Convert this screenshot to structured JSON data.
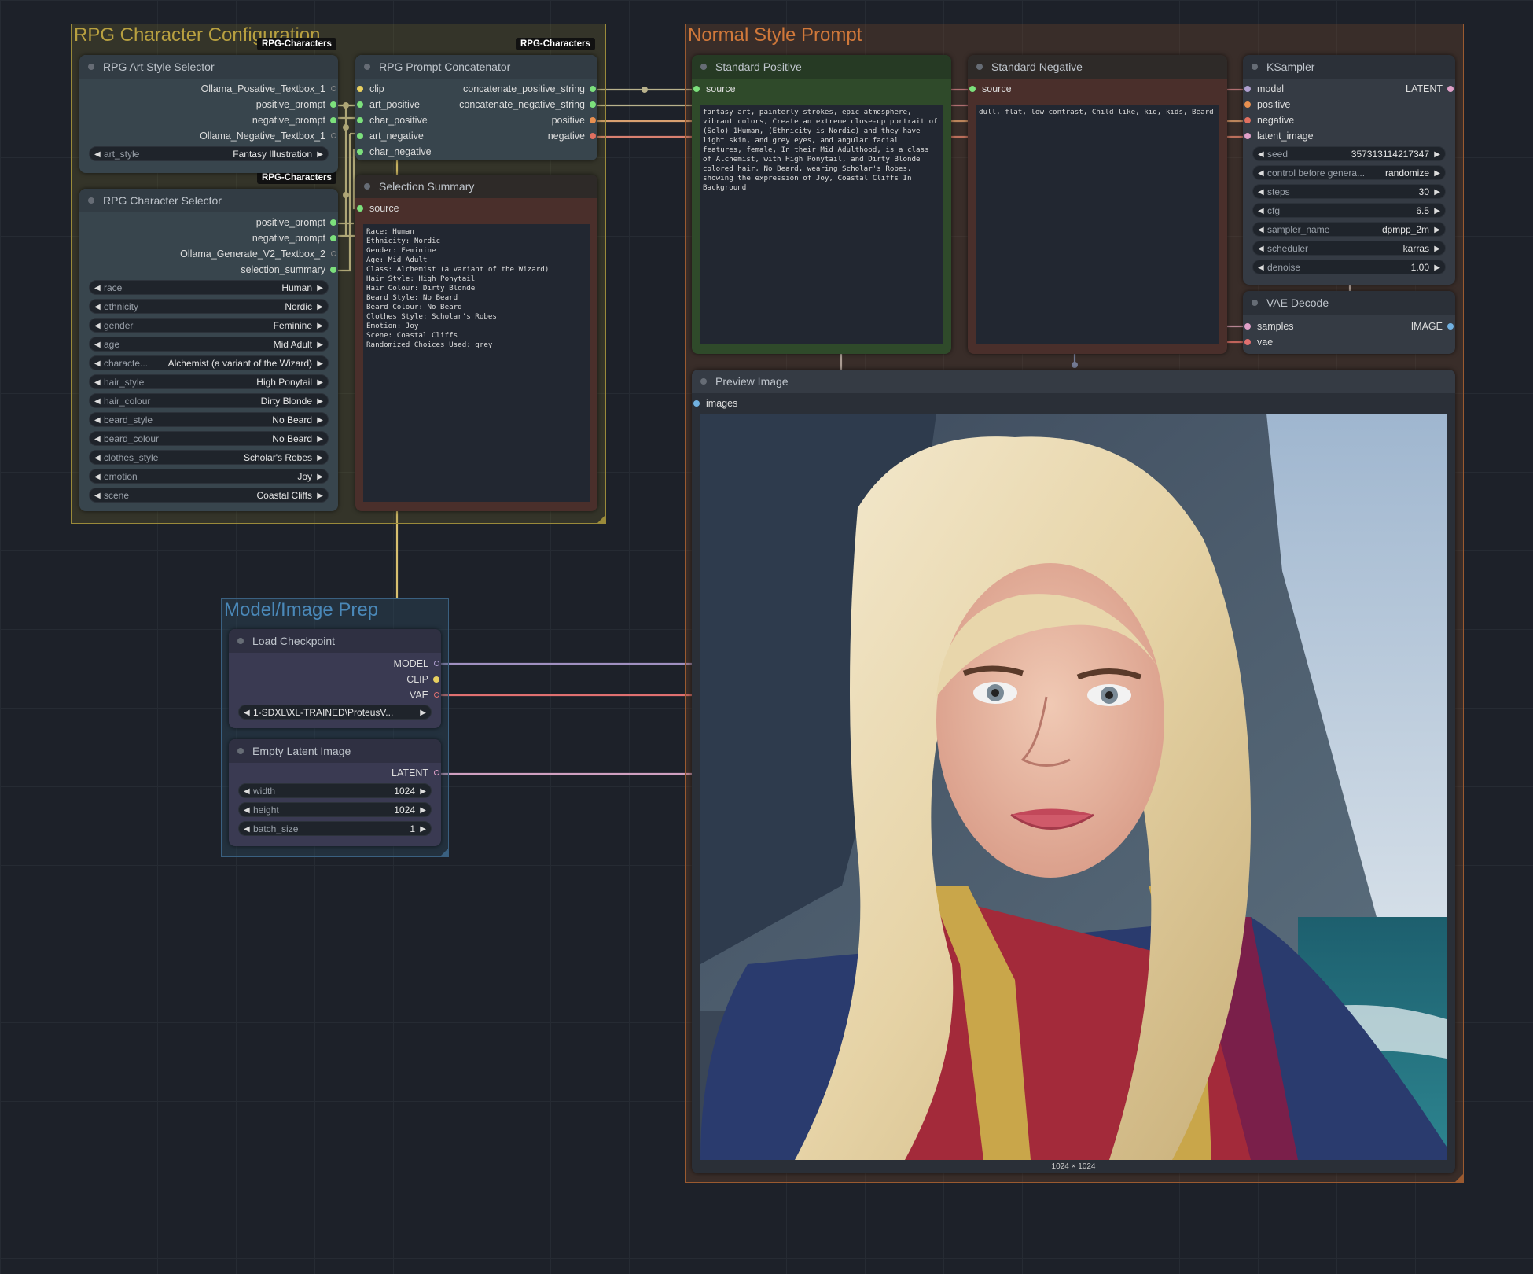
{
  "groups": {
    "rpg": {
      "title": "RPG Character Configuration"
    },
    "normal": {
      "title": "Normal Style Prompt"
    },
    "prep": {
      "title": "Model/Image Prep"
    }
  },
  "badges": {
    "badge1": "RPG-Characters",
    "badge2": "RPG-Characters",
    "badge3": "RPG-Characters"
  },
  "art_style_selector": {
    "title": "RPG Art Style Selector",
    "outputs": [
      "Ollama_Posative_Textbox_1",
      "positive_prompt",
      "negative_prompt",
      "Ollama_Negative_Textbox_1"
    ],
    "widget": {
      "label": "art_style",
      "value": "Fantasy Illustration"
    }
  },
  "prompt_concat": {
    "title": "RPG Prompt Concatenator",
    "inputs": [
      "clip",
      "art_positive",
      "char_positive",
      "art_negative",
      "char_negative"
    ],
    "outputs": [
      "concatenate_positive_string",
      "concatenate_negative_string",
      "positive",
      "negative"
    ]
  },
  "char_selector": {
    "title": "RPG Character Selector",
    "outputs": [
      "positive_prompt",
      "negative_prompt",
      "Ollama_Generate_V2_Textbox_2",
      "selection_summary"
    ],
    "widgets": [
      {
        "label": "race",
        "value": "Human"
      },
      {
        "label": "ethnicity",
        "value": "Nordic"
      },
      {
        "label": "gender",
        "value": "Feminine"
      },
      {
        "label": "age",
        "value": "Mid Adult"
      },
      {
        "label": "characte...",
        "value": "Alchemist (a variant of the Wizard)"
      },
      {
        "label": "hair_style",
        "value": "High Ponytail"
      },
      {
        "label": "hair_colour",
        "value": "Dirty Blonde"
      },
      {
        "label": "beard_style",
        "value": "No Beard"
      },
      {
        "label": "beard_colour",
        "value": "No Beard"
      },
      {
        "label": "clothes_style",
        "value": "Scholar's Robes"
      },
      {
        "label": "emotion",
        "value": "Joy"
      },
      {
        "label": "scene",
        "value": "Coastal Cliffs"
      }
    ]
  },
  "selection_summary": {
    "title": "Selection Summary",
    "input": "source",
    "text": "Race: Human\nEthnicity: Nordic\nGender: Feminine\nAge: Mid Adult\nClass: Alchemist (a variant of the Wizard)\nHair Style: High Ponytail\nHair Colour: Dirty Blonde\nBeard Style: No Beard\nBeard Colour: No Beard\nClothes Style: Scholar's Robes\nEmotion: Joy\nScene: Coastal Cliffs\nRandomized Choices Used: grey"
  },
  "std_positive": {
    "title": "Standard Positive",
    "input": "source",
    "text": "fantasy art, painterly strokes, epic atmosphere, vibrant colors, Create an extreme close-up portrait of (Solo) 1Human, (Ethnicity is Nordic) and they have light skin, and grey eyes, and angular facial features, female, In their Mid Adulthood, is a class of Alchemist, with High Ponytail, and Dirty Blonde colored hair, No Beard, wearing Scholar's Robes, showing the expression of Joy, Coastal Cliffs In Background"
  },
  "std_negative": {
    "title": "Standard Negative",
    "input": "source",
    "text": "dull, flat, low contrast, Child like, kid, kids, Beard"
  },
  "ksampler": {
    "title": "KSampler",
    "inputs": [
      "model",
      "positive",
      "negative",
      "latent_image"
    ],
    "output": "LATENT",
    "widgets": [
      {
        "label": "seed",
        "value": "357313114217347"
      },
      {
        "label": "control before genera...",
        "value": "randomize"
      },
      {
        "label": "steps",
        "value": "30"
      },
      {
        "label": "cfg",
        "value": "6.5"
      },
      {
        "label": "sampler_name",
        "value": "dpmpp_2m"
      },
      {
        "label": "scheduler",
        "value": "karras"
      },
      {
        "label": "denoise",
        "value": "1.00"
      }
    ]
  },
  "vae_decode": {
    "title": "VAE Decode",
    "inputs": [
      "samples",
      "vae"
    ],
    "output": "IMAGE"
  },
  "preview": {
    "title": "Preview Image",
    "input": "images",
    "size_label": "1024 × 1024"
  },
  "load_ckpt": {
    "title": "Load Checkpoint",
    "outputs": [
      "MODEL",
      "CLIP",
      "VAE"
    ],
    "widget": {
      "value": "1-SDXL\\XL-TRAINED\\ProteusV..."
    }
  },
  "empty_latent": {
    "title": "Empty Latent Image",
    "output": "LATENT",
    "widgets": [
      {
        "label": "width",
        "value": "1024"
      },
      {
        "label": "height",
        "value": "1024"
      },
      {
        "label": "batch_size",
        "value": "1"
      }
    ]
  },
  "colors": {
    "rpg_group": "#8a7a2a",
    "normal_group": "#7a4a2c",
    "prep_group": "#2e4a60",
    "green_node": "#2f4a2a",
    "red_node": "#5a3430"
  }
}
